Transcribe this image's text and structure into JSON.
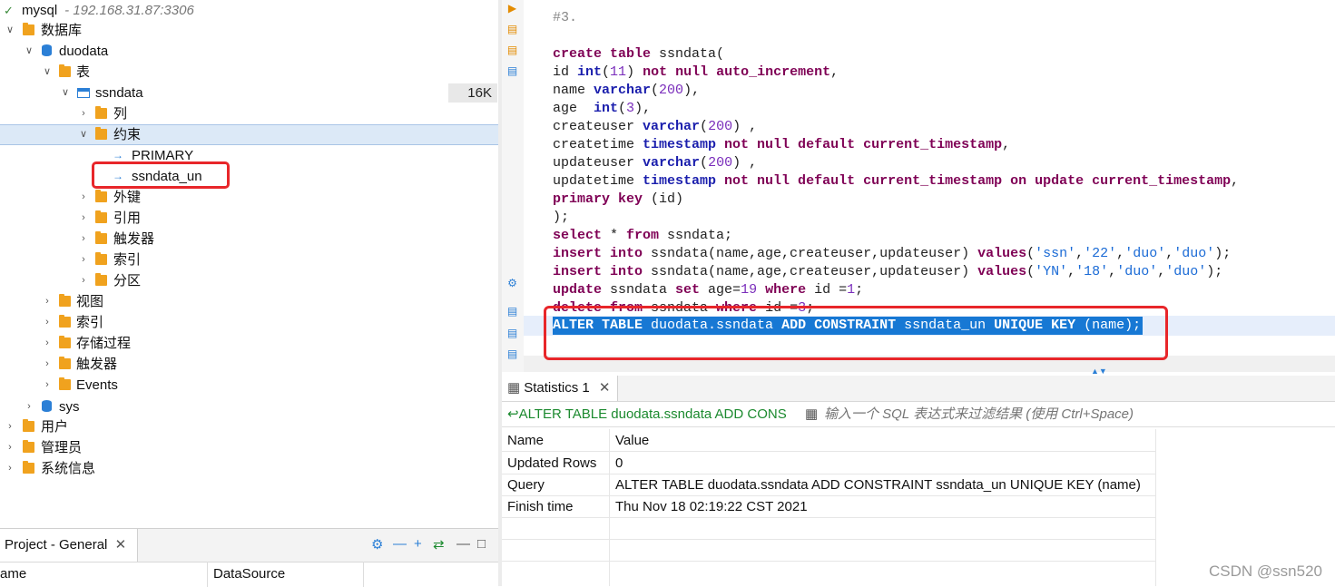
{
  "navigator": {
    "connection": {
      "name": "mysql",
      "host": "- 192.168.31.87:3306"
    },
    "items": {
      "databases": "数据库",
      "duodata": "duodata",
      "tables": "表",
      "ssndata": "ssndata",
      "ssndata_size": "16K",
      "columns": "列",
      "constraints": "约束",
      "primary": "PRIMARY",
      "ssndata_un": "ssndata_un",
      "foreign_keys": "外键",
      "references": "引用",
      "triggers_t": "触发器",
      "indexes_t": "索引",
      "partitions": "分区",
      "views": "视图",
      "indexes": "索引",
      "procedures": "存储过程",
      "triggers": "触发器",
      "events": "Events",
      "sys": "sys",
      "users": "用户",
      "admin": "管理员",
      "sysinfo": "系统信息"
    }
  },
  "project": {
    "tab_label": "Project - General",
    "col_name": "ame",
    "col_datasource": "DataSource"
  },
  "editor": {
    "lines": {
      "l1": "#3.",
      "create": "create",
      "table": "table",
      "create_rest": " ssndata(",
      "id": "id ",
      "int": "int",
      "p11": "(",
      "n11": "11",
      "p11c": ") ",
      "notnull": "not null",
      "autoinc": " auto_increment",
      "comma1": ",",
      "name": "name ",
      "varchar": "varchar",
      "n200": "200",
      "name_end": "),",
      "age": "age  ",
      "int2": "int",
      "n3": "3",
      "age_end": "),",
      "cu": "createuser ",
      "varchar2": "varchar",
      "n200b": "200",
      "cu_end": ") ,",
      "ct": "createtime ",
      "timestamp": "timestamp",
      "ct_kw": " not null default current_timestamp",
      "ct_end": ",",
      "uu": "updateuser ",
      "varchar3": "varchar",
      "n200c": "200",
      "uu_end": ") ,",
      "ut": "updatetime ",
      "timestamp2": "timestamp",
      "ut_kw1": " not null default current_timestamp on update current_timestamp",
      "ut_end": ",",
      "pk": "primary key",
      "pk_rest": " (id)",
      "close": ");",
      "select": "select",
      "sel_rest": " * ",
      "from": "from",
      "sel_tbl": " ssndata;",
      "insert1": "insert into",
      "ins1_a": " ssndata(name,age,createuser,updateuser) ",
      "values1": "values",
      "ins1_b": "(",
      "s1": "'ssn'",
      "c1": ",",
      "s2": "'22'",
      "c2": ",",
      "s3": "'duo'",
      "c3": ",",
      "s4": "'duo'",
      "e1": ");",
      "insert2": "insert into",
      "ins2_a": " ssndata(name,age,createuser,updateuser) ",
      "values2": "values",
      "ins2_b": "(",
      "t1": "'YN'",
      "d1": ",",
      "t2": "'18'",
      "d2": ",",
      "t3": "'duo'",
      "d3": ",",
      "t4": "'duo'",
      "e2": ");",
      "update": "update",
      "upd_a": " ssndata ",
      "set": "set",
      "upd_b": " age=",
      "n19": "19",
      "where": " where",
      "upd_c": " id =",
      "n1": "1",
      "upd_end": ";",
      "delete": "delete from",
      "del_a": " ssndata ",
      "where2": "where",
      "del_b": " id =",
      "n3b": "3",
      "del_end": ";",
      "alter_k1": "ALTER TABLE",
      "alter_a": " duodata.ssndata ",
      "alter_k2": "ADD CONSTRAINT",
      "alter_b": " ssndata_un ",
      "alter_k3": "UNIQUE KEY",
      "alter_c": " (name);"
    }
  },
  "results": {
    "tab_label": "Statistics 1",
    "filter_query": "ALTER TABLE duodata.ssndata ADD CONS",
    "filter_placeholder": "输入一个 SQL 表达式来过滤结果 (使用 Ctrl+Space)",
    "header": {
      "name": "Name",
      "value": "Value"
    },
    "rows": [
      {
        "name": "Updated Rows",
        "value": "0"
      },
      {
        "name": "Query",
        "value": "ALTER TABLE duodata.ssndata ADD CONSTRAINT ssndata_un UNIQUE KEY (name)"
      },
      {
        "name": "Finish time",
        "value": "Thu Nov 18 02:19:22 CST 2021"
      }
    ]
  },
  "watermark": "CSDN @ssn520",
  "colors": {
    "highlight_box": "#e8262a",
    "selection": "#1778d4",
    "keyword": "#7f0055",
    "type": "#1b1fad"
  }
}
